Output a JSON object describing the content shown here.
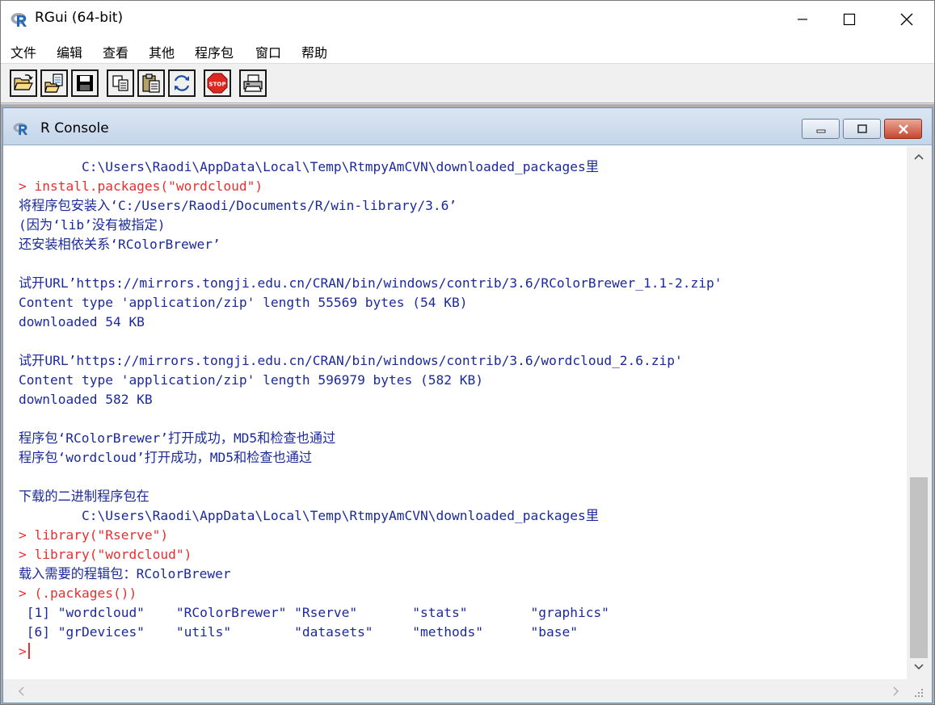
{
  "window": {
    "title": "RGui (64-bit)"
  },
  "menu": [
    "文件",
    "编辑",
    "查看",
    "其他",
    "程序包",
    "窗口",
    "帮助"
  ],
  "toolbar": {
    "buttons": [
      "open-script-icon",
      "load-workspace-icon",
      "save-icon",
      "copy-icon",
      "paste-icon",
      "copy-paste-icon",
      "stop-icon",
      "print-icon"
    ],
    "stop_label": "STOP"
  },
  "console": {
    "title": "R Console",
    "lines": [
      {
        "kind": "out",
        "text": "        C:\\Users\\Raodi\\AppData\\Local\\Temp\\RtmpyAmCVN\\downloaded_packages里"
      },
      {
        "kind": "in",
        "text": "> install.packages(\"wordcloud\")"
      },
      {
        "kind": "out",
        "text": "将程序包安装入‘C:/Users/Raodi/Documents/R/win-library/3.6’"
      },
      {
        "kind": "out",
        "text": "(因为‘lib’没有被指定)"
      },
      {
        "kind": "out",
        "text": "还安装相依关系‘RColorBrewer’"
      },
      {
        "kind": "out",
        "text": ""
      },
      {
        "kind": "out",
        "text": "试开URL’https://mirrors.tongji.edu.cn/CRAN/bin/windows/contrib/3.6/RColorBrewer_1.1-2.zip'"
      },
      {
        "kind": "out",
        "text": "Content type 'application/zip' length 55569 bytes (54 KB)"
      },
      {
        "kind": "out",
        "text": "downloaded 54 KB"
      },
      {
        "kind": "out",
        "text": ""
      },
      {
        "kind": "out",
        "text": "试开URL’https://mirrors.tongji.edu.cn/CRAN/bin/windows/contrib/3.6/wordcloud_2.6.zip'"
      },
      {
        "kind": "out",
        "text": "Content type 'application/zip' length 596979 bytes (582 KB)"
      },
      {
        "kind": "out",
        "text": "downloaded 582 KB"
      },
      {
        "kind": "out",
        "text": ""
      },
      {
        "kind": "out",
        "text": "程序包‘RColorBrewer’打开成功，MD5和检查也通过"
      },
      {
        "kind": "out",
        "text": "程序包‘wordcloud’打开成功，MD5和检查也通过"
      },
      {
        "kind": "out",
        "text": ""
      },
      {
        "kind": "out",
        "text": "下载的二进制程序包在"
      },
      {
        "kind": "out",
        "text": "        C:\\Users\\Raodi\\AppData\\Local\\Temp\\RtmpyAmCVN\\downloaded_packages里"
      },
      {
        "kind": "in",
        "text": "> library(\"Rserve\")"
      },
      {
        "kind": "in",
        "text": "> library(\"wordcloud\")"
      },
      {
        "kind": "out",
        "text": "载入需要的程辑包：RColorBrewer"
      },
      {
        "kind": "in",
        "text": "> (.packages())"
      },
      {
        "kind": "out",
        "text": " [1] \"wordcloud\"    \"RColorBrewer\" \"Rserve\"       \"stats\"        \"graphics\""
      },
      {
        "kind": "out",
        "text": " [6] \"grDevices\"    \"utils\"        \"datasets\"     \"methods\"      \"base\""
      }
    ],
    "prompt": ">"
  }
}
